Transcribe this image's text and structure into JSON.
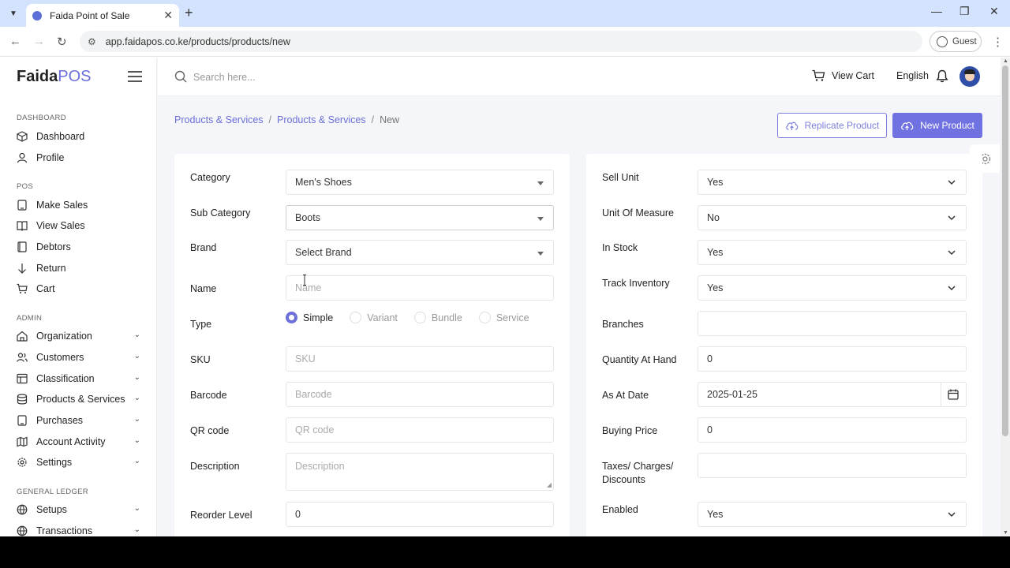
{
  "browser": {
    "tab_title": "Faida Point of Sale",
    "url": "app.faidapos.co.ke/products/products/new",
    "profile_label": "Guest"
  },
  "app": {
    "logo_main": "Faida",
    "logo_accent": "POS",
    "brand_color": "#6c6fd8"
  },
  "topbar": {
    "search_placeholder": "Search here...",
    "view_cart": "View Cart",
    "language": "English"
  },
  "sidebar": {
    "sections": {
      "dashboard": "DASHBOARD",
      "pos": "POS",
      "admin": "ADMIN",
      "general_ledger": "GENERAL LEDGER"
    },
    "items": {
      "dashboard": "Dashboard",
      "profile": "Profile",
      "make_sales": "Make Sales",
      "view_sales": "View Sales",
      "debtors": "Debtors",
      "return": "Return",
      "cart": "Cart",
      "organization": "Organization",
      "customers": "Customers",
      "classification": "Classification",
      "products_services": "Products & Services",
      "purchases": "Purchases",
      "account_activity": "Account Activity",
      "settings": "Settings",
      "setups": "Setups",
      "transactions": "Transactions"
    }
  },
  "breadcrumb": {
    "level1": "Products & Services",
    "level2": "Products & Services",
    "current": "New",
    "separator": "/"
  },
  "actions": {
    "replicate": "Replicate Product",
    "new_product": "New Product"
  },
  "form_left": {
    "category": {
      "label": "Category",
      "value": "Men's Shoes"
    },
    "sub_category": {
      "label": "Sub Category",
      "value": "Boots"
    },
    "brand": {
      "label": "Brand",
      "placeholder": "Select Brand"
    },
    "name": {
      "label": "Name",
      "placeholder": "Name"
    },
    "type": {
      "label": "Type",
      "options": [
        "Simple",
        "Variant",
        "Bundle",
        "Service"
      ],
      "selected": "Simple"
    },
    "sku": {
      "label": "SKU",
      "placeholder": "SKU"
    },
    "barcode": {
      "label": "Barcode",
      "placeholder": "Barcode"
    },
    "qr_code": {
      "label": "QR code",
      "placeholder": "QR code"
    },
    "description": {
      "label": "Description",
      "placeholder": "Description"
    },
    "reorder_level": {
      "label": "Reorder Level",
      "value": "0"
    }
  },
  "form_right": {
    "sell_unit": {
      "label": "Sell Unit",
      "value": "Yes"
    },
    "unit_of_measure": {
      "label": "Unit Of Measure",
      "value": "No"
    },
    "in_stock": {
      "label": "In Stock",
      "value": "Yes"
    },
    "track_inventory": {
      "label": "Track Inventory",
      "value": "Yes"
    },
    "branches": {
      "label": "Branches",
      "value": ""
    },
    "quantity_at_hand": {
      "label": "Quantity At Hand",
      "value": "0"
    },
    "as_at_date": {
      "label": "As At Date",
      "value": "2025-01-25"
    },
    "buying_price": {
      "label": "Buying Price",
      "value": "0"
    },
    "taxes": {
      "label_line1": "Taxes/ Charges/",
      "label_line2": "Discounts",
      "value": ""
    },
    "enabled": {
      "label": "Enabled",
      "value": "Yes"
    }
  }
}
